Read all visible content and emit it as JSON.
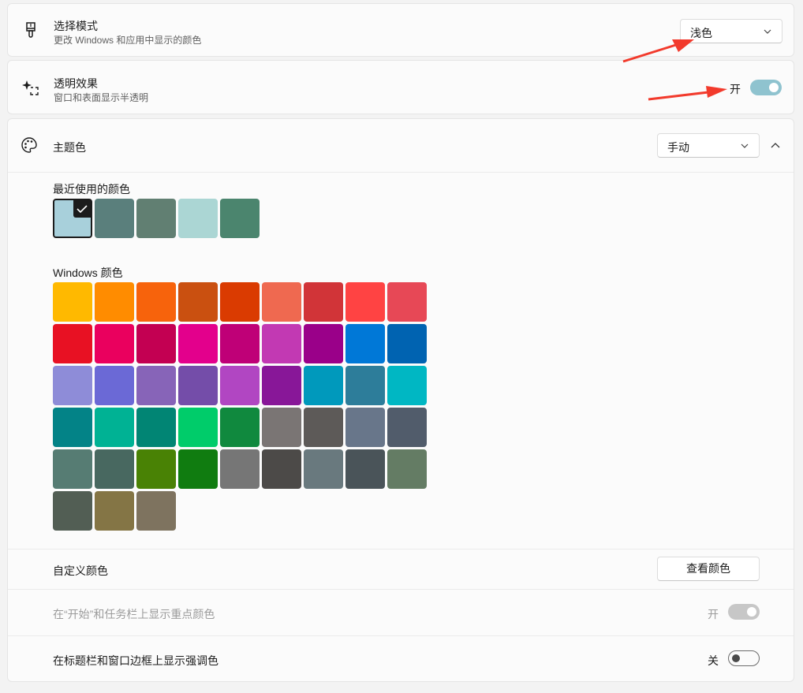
{
  "mode": {
    "title": "选择模式",
    "description": "更改 Windows 和应用中显示的颜色",
    "dropdown_value": "浅色",
    "icon": "paintbrush-icon"
  },
  "transparency": {
    "title": "透明效果",
    "description": "窗口和表面显示半透明",
    "state_label": "开",
    "toggle_on": true,
    "icon": "sparkle-icon"
  },
  "accent": {
    "title": "主题色",
    "dropdown_value": "手动",
    "icon": "palette-icon",
    "recent_label": "最近使用的颜色",
    "recent_colors": [
      "#a8d0db",
      "#5a7f7c",
      "#617f72",
      "#abd6d4",
      "#4b856e"
    ],
    "recent_selected_index": 0,
    "windows_label": "Windows 颜色",
    "windows_colors": [
      [
        "#ffb900",
        "#ff8c00",
        "#f7630c",
        "#ca5010",
        "#da3b01",
        "#ef6950",
        "#d13438",
        "#ff4343",
        "#e74856"
      ],
      [
        "#e81123",
        "#ea005e",
        "#c30052",
        "#e3008c",
        "#bf0077",
        "#c239b3",
        "#9a0089",
        "#0078d7",
        "#0063b1"
      ],
      [
        "#8e8cd8",
        "#6b69d6",
        "#8764b8",
        "#744da9",
        "#b146c2",
        "#881798",
        "#0099bc",
        "#2d7d9a",
        "#00b7c3"
      ],
      [
        "#038387",
        "#00b294",
        "#018574",
        "#00cc6a",
        "#10893e",
        "#7a7574",
        "#5d5a58",
        "#68768a",
        "#515c6b"
      ],
      [
        "#567c73",
        "#486860",
        "#498205",
        "#107c10",
        "#767676",
        "#4c4a48",
        "#69797e",
        "#4a5459",
        "#647c64"
      ],
      [
        "#525e54",
        "#847545",
        "#7e735f"
      ]
    ],
    "custom_label": "自定义颜色",
    "custom_button": "查看颜色",
    "start_taskbar_label": "在“开始”和任务栏上显示重点颜色",
    "start_taskbar_state": "开",
    "start_taskbar_enabled": false,
    "titlebar_label": "在标题栏和窗口边框上显示强调色",
    "titlebar_state": "关",
    "titlebar_on": false
  },
  "annotation_color": "#f23a2c"
}
